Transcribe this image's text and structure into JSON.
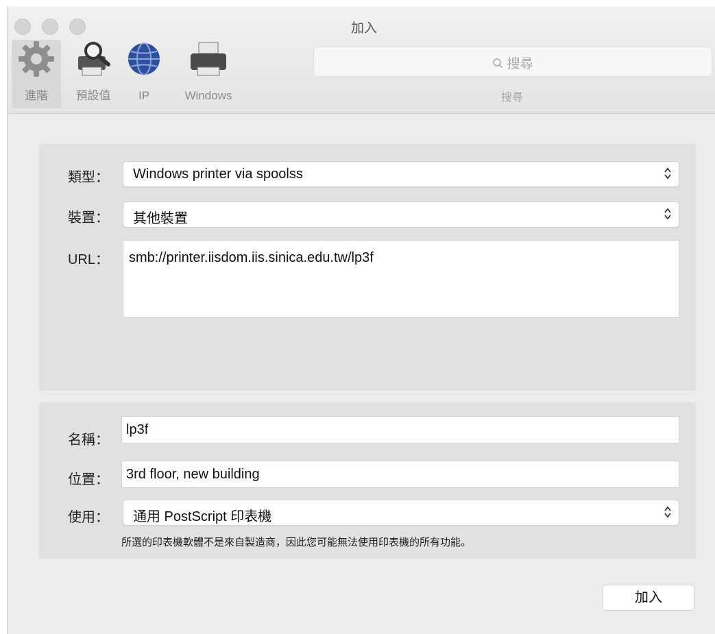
{
  "window": {
    "title": "加入"
  },
  "toolbar": {
    "items": [
      {
        "label": "進階",
        "icon": "gear-icon",
        "selected": true
      },
      {
        "label": "預設值",
        "icon": "printer-search-icon",
        "selected": false
      },
      {
        "label": "IP",
        "icon": "globe-icon",
        "selected": false
      },
      {
        "label": "Windows",
        "icon": "printer-icon",
        "selected": false
      }
    ],
    "search": {
      "placeholder": "搜尋",
      "caption": "搜尋"
    }
  },
  "form": {
    "type": {
      "label": "類型：",
      "value": "Windows printer via spoolss"
    },
    "device": {
      "label": "裝置：",
      "value": "其他裝置"
    },
    "url": {
      "label": "URL：",
      "value": "smb://printer.iisdom.iis.sinica.edu.tw/lp3f"
    },
    "name": {
      "label": "名稱：",
      "value": "lp3f"
    },
    "location": {
      "label": "位置：",
      "value": "3rd floor, new building"
    },
    "use": {
      "label": "使用：",
      "value": "通用 PostScript 印表機"
    },
    "driver_note": "所選的印表機軟體不是來自製造商，因此您可能無法使用印表機的所有功能。"
  },
  "buttons": {
    "add": "加入"
  },
  "colors": {
    "window_bg": "#ececec",
    "panel_bg": "#e1e1e1",
    "globe": "#2d4fa0"
  }
}
